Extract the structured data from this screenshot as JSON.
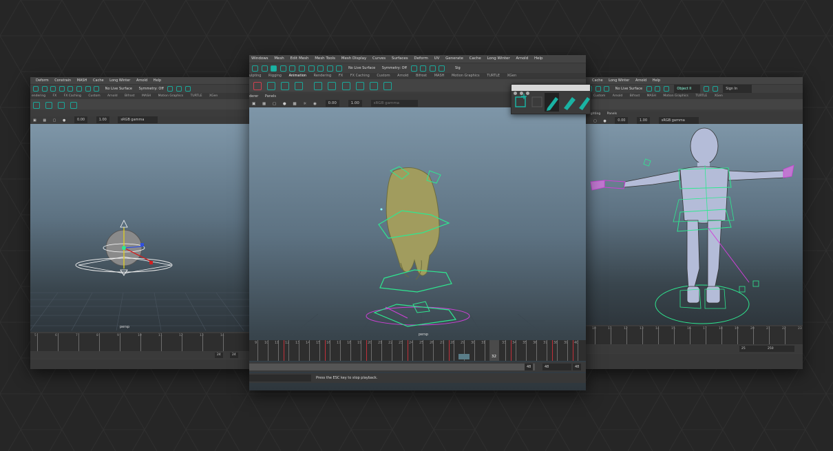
{
  "left_window": {
    "menu": [
      "Deform",
      "Constrain",
      "MASH",
      "Cache",
      "Long Winter",
      "Arnold",
      "Help"
    ],
    "live_surface": "No Live Surface",
    "symmetry": "Symmetry: Off",
    "shelf_tabs": [
      "endering",
      "FX",
      "FX Caching",
      "Custom",
      "Arnold",
      "Bifrost",
      "MASH",
      "Motion Graphics",
      "TURTLE",
      "XGen"
    ],
    "viewport_value_a": "0.00",
    "viewport_value_b": "1.00",
    "color_space": "sRGB gamma",
    "camera_label": "persp",
    "timeline_numbers": [
      "5",
      "6",
      "7",
      "8",
      "9",
      "10",
      "11",
      "12",
      "13",
      "14"
    ],
    "range_end": "24",
    "range_end_b": "24"
  },
  "center_window": {
    "menu": [
      "Windows",
      "Mesh",
      "Edit Mesh",
      "Mesh Tools",
      "Mesh Display",
      "Curves",
      "Surfaces",
      "Deform",
      "UV",
      "Generate",
      "Cache",
      "Long Winter",
      "Arnold",
      "Help"
    ],
    "live_surface": "No Live Surface",
    "symmetry": "Symmetry: Off",
    "shelf_tabs": [
      "ulpting",
      "Rigging",
      "Animation",
      "Rendering",
      "FX",
      "FX Caching",
      "Custom",
      "Arnold",
      "Bifrost",
      "MASH",
      "Motion Graphics",
      "TURTLE",
      "XGen"
    ],
    "active_shelf_tab": "Animation",
    "panel_menu": [
      "derer",
      "Panels"
    ],
    "viewport_value_a": "0.00",
    "viewport_value_b": "1.00",
    "color_space": "sRGB gamma",
    "camera_label": "persp",
    "timeline_numbers": [
      "9",
      "10",
      "11",
      "12",
      "13",
      "14",
      "15",
      "16",
      "17",
      "18",
      "19",
      "20",
      "21",
      "22",
      "23",
      "24",
      "25",
      "26",
      "27",
      "28",
      "29",
      "30",
      "31",
      "32",
      "33",
      "34",
      "35",
      "36",
      "37",
      "38",
      "39",
      "40",
      "41"
    ],
    "current_frame": "32",
    "range_end": "48",
    "range_end_b": "48",
    "range_end_c": "48",
    "status_message": "Press the ESC key to stop playback.",
    "sign_in": "Sig"
  },
  "right_window": {
    "menu": [
      "Cache",
      "Long Winter",
      "Arnold",
      "Help"
    ],
    "live_surface": "No Live Surface",
    "object_field": "Object II",
    "sign_in": "Sign In",
    "shelf_tabs": [
      "Custom",
      "Arnold",
      "Bifrost",
      "MASH",
      "Motion Graphics",
      "TURTLE",
      "XGen"
    ],
    "panel_menu": [
      "Lighting",
      "Panels"
    ],
    "viewport_value_a": "0.00",
    "viewport_value_b": "1.00",
    "color_space": "sRGB gamma",
    "timeline_numbers": [
      "10",
      "11",
      "12",
      "13",
      "14",
      "15",
      "16",
      "17",
      "18",
      "19",
      "20",
      "21",
      "22",
      "23"
    ],
    "range_end": "25",
    "range_end_b": "250"
  },
  "colors": {
    "accent": "#1ab3a3",
    "keyframe": "#c2303a",
    "viewport_top": "#7e96a8",
    "viewport_bottom": "#2e363c",
    "rig_green": "#2ee890",
    "rig_magenta": "#d040d8"
  },
  "icons": [
    "select-tool-icon",
    "lasso-tool-icon",
    "move-tool-icon",
    "rotate-tool-icon",
    "scale-tool-icon",
    "snap-icon",
    "camera-icon",
    "render-icon",
    "pencil-icon",
    "marker-icon",
    "frame-icon"
  ]
}
